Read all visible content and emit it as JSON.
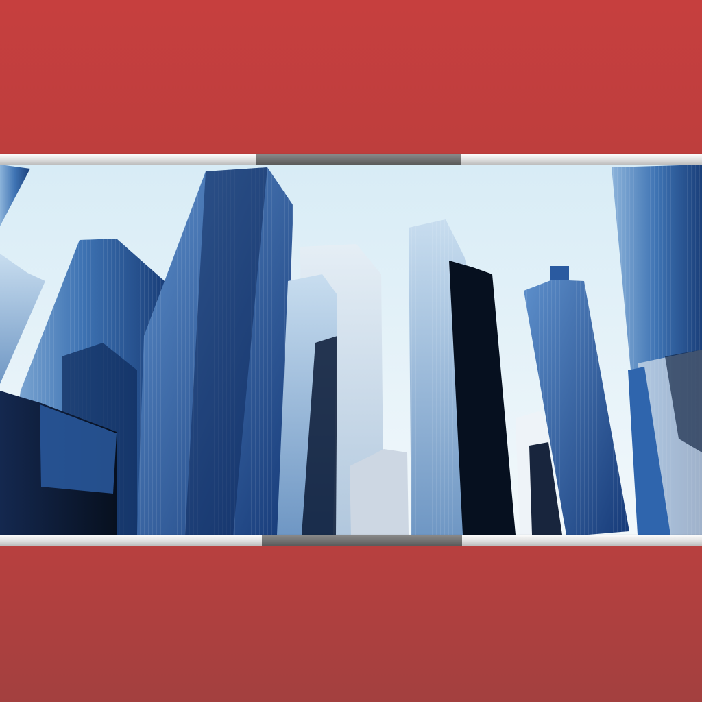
{
  "scene": {
    "subject": "city-skyline-photo",
    "colors": {
      "background_red": "#c23f3e",
      "rail_light": "#e8e8e8",
      "rail_dark": "#747474",
      "sky": "#d8ecf6",
      "glass_blue": "#1f4f8f",
      "dark_navy": "#0c1a35"
    }
  }
}
